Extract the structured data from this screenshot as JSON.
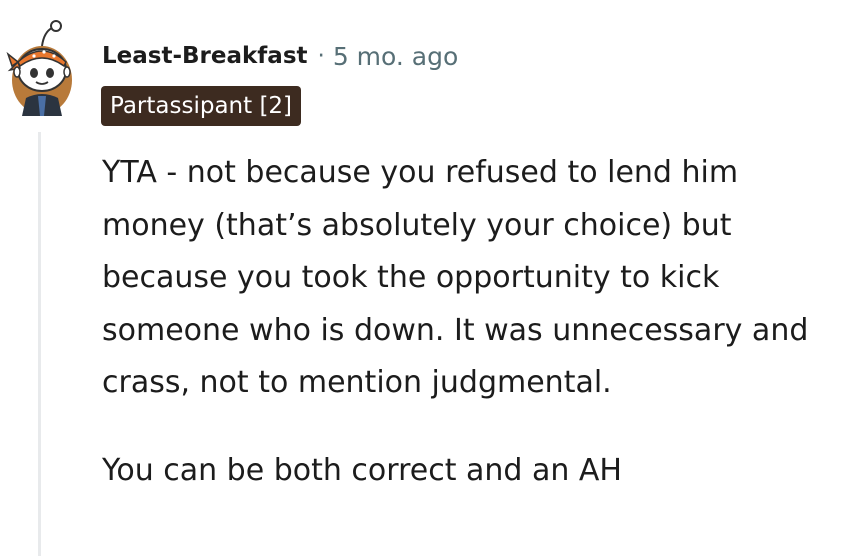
{
  "comment": {
    "author": "Least-Breakfast",
    "separator": "·",
    "timestamp": "5 mo. ago",
    "flair": "Partassipant [2]",
    "avatar_icon": "snoo-avatar-orange-bandana",
    "colors": {
      "flair_bg": "#3d2b20",
      "flair_text": "#ffffff",
      "meta_text": "#576f76",
      "thread_line": "#e8eaec"
    },
    "paragraphs": [
      "YTA - not because you refused to lend him money (that’s absolutely your choice) but because you took the opportunity to kick someone who is down. It was unnecessary and crass, not to mention judgmental.",
      "You can be both correct and an AH"
    ]
  }
}
